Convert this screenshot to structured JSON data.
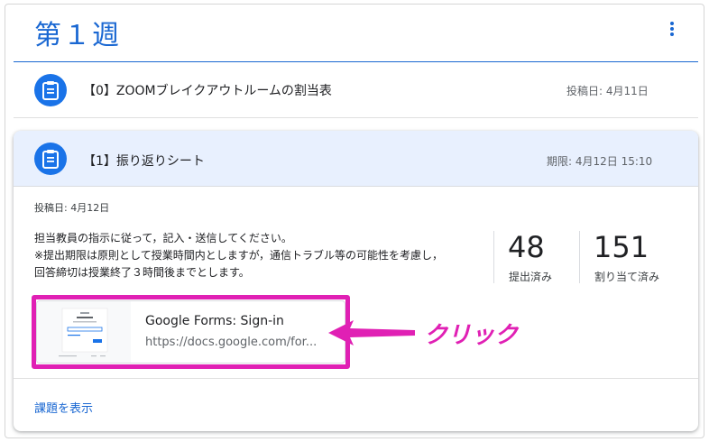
{
  "topic": {
    "title": "第１週"
  },
  "items": [
    {
      "title": "【0】ZOOMブレイクアウトルームの割当表",
      "meta": "投稿日: 4月11日"
    },
    {
      "title": "【1】振り返りシート",
      "meta": "期限: 4月12日 15:10"
    }
  ],
  "expanded": {
    "posted": "投稿日: 4月12日",
    "instructions": [
      "担当教員の指示に従って，記入・送信してください。",
      "※提出期限は原則として授業時間内としますが，通信トラブル等の可能性を考慮し，",
      "回答締切は授業終了３時間後までとします。"
    ],
    "stats": [
      {
        "value": "48",
        "label": "提出済み"
      },
      {
        "value": "151",
        "label": "割り当て済み"
      }
    ],
    "attachment": {
      "title": "Google Forms: Sign-in",
      "url": "https://docs.google.com/for..."
    },
    "view_link": "課題を表示"
  },
  "annotation": {
    "label": "クリック",
    "color": "#e020b4"
  },
  "colors": {
    "accent": "#1967d2",
    "icon_bg": "#1a73e8",
    "header_bg": "#e8f0fe"
  },
  "icons": {
    "assignment": "assignment-icon",
    "more": "more-vert-icon"
  }
}
